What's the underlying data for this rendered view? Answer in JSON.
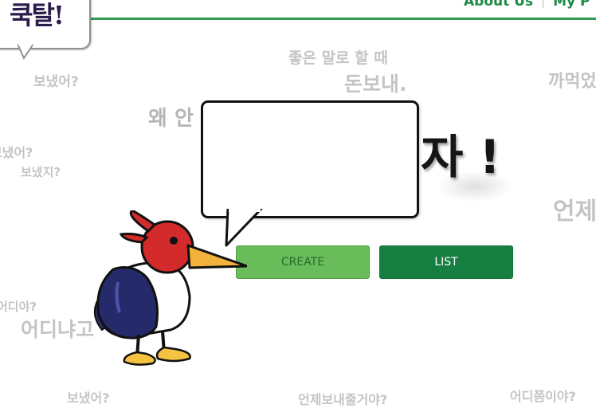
{
  "header": {
    "nav": [
      {
        "label": "About Us"
      },
      {
        "label": "My P"
      }
    ],
    "logo_text": "쿡탈!"
  },
  "background_phrases": [
    "보냈어?",
    "좋은 말로 할 때",
    "돈보내.",
    "까먹었",
    "왜 안",
    "보냈어?",
    "보냈지?",
    "언제",
    "어디야?",
    "어디냐고",
    "보냈어?",
    "언제보내줄거야?",
    "어디쯤이야?"
  ],
  "title": "자 !",
  "buttons": {
    "create": "CREATE",
    "list": "LIST"
  },
  "colors": {
    "accent": "#2e9a54",
    "create_bg": "#6abc5a",
    "list_bg": "#177e41"
  }
}
